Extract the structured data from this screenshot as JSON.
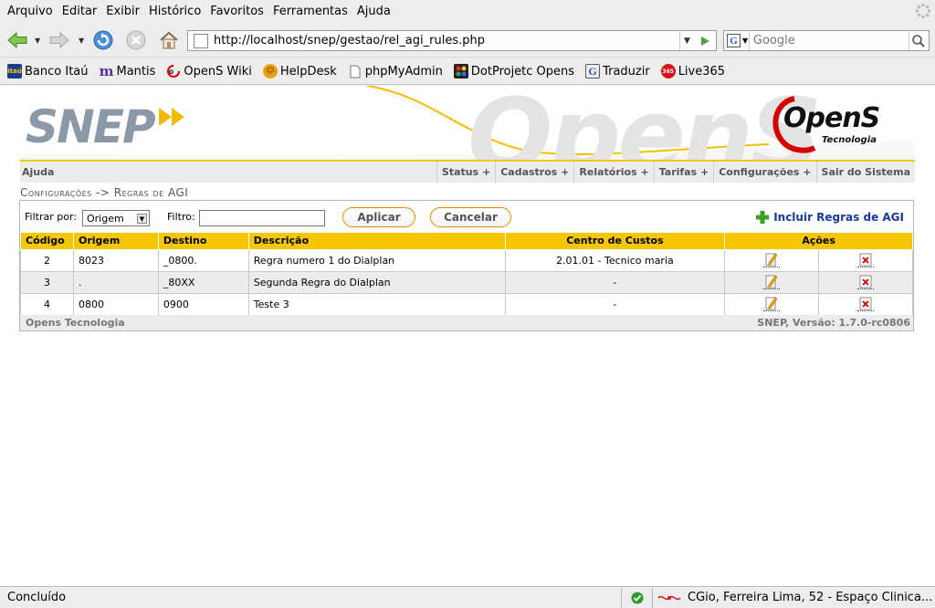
{
  "menubar": {
    "items": [
      "Arquivo",
      "Editar",
      "Exibir",
      "Histórico",
      "Favoritos",
      "Ferramentas",
      "Ajuda"
    ]
  },
  "navbar": {
    "url": "http://localhost/snep/gestao/rel_agi_rules.php",
    "search_placeholder": "Google"
  },
  "bookmarks": [
    {
      "label": "Banco Itaú",
      "icon": "itau-icon"
    },
    {
      "label": "Mantis",
      "icon": "mantis-icon"
    },
    {
      "label": "OpenS Wiki",
      "icon": "opens-icon"
    },
    {
      "label": "HelpDesk",
      "icon": "helpdesk-icon"
    },
    {
      "label": "phpMyAdmin",
      "icon": "page-icon"
    },
    {
      "label": "DotProjetc Opens",
      "icon": "dotproject-icon"
    },
    {
      "label": "Traduzir",
      "icon": "google-icon"
    },
    {
      "label": "Live365",
      "icon": "live365-icon"
    }
  ],
  "header": {
    "logo_left": "SNEP",
    "logo_right": "OpenS",
    "logo_right_sub": "Tecnologia",
    "watermark": "OpenS"
  },
  "menu2": {
    "help": "Ajuda",
    "items": [
      "Status +",
      "Cadastros +",
      "Relatórios +",
      "Tarifas +",
      "Configurações +",
      "Sair do Sistema"
    ]
  },
  "breadcrumb": "Configurações -> Regras de AGI",
  "filter": {
    "filter_by_label": "Filtrar por:",
    "filter_by_value": "Origem",
    "filter_label": "Filtro:",
    "filter_value": "",
    "apply_label": "Aplicar",
    "cancel_label": "Cancelar",
    "add_label": "Incluir Regras de AGI"
  },
  "table": {
    "headers": [
      "Código",
      "Origem",
      "Destino",
      "Descrição",
      "Centro de Custos",
      "Ações"
    ],
    "rows": [
      {
        "codigo": "2",
        "origem": "8023",
        "destino": "_0800.",
        "descricao": "Regra numero 1 do Dialplan",
        "centro": "2.01.01 - Tecnico maria"
      },
      {
        "codigo": "3",
        "origem": ".",
        "destino": "_80XX",
        "descricao": "Segunda Regra do Dialplan",
        "centro": "-"
      },
      {
        "codigo": "4",
        "origem": "0800",
        "destino": "0900",
        "descricao": "Teste 3",
        "centro": "-"
      }
    ]
  },
  "footer": {
    "left": "Opens Tecnologia",
    "right": "SNEP, Versão: 1.7.0-rc0806"
  },
  "statusbar": {
    "status": "Concluído",
    "extension_text": "CGio, Ferreira Lima, 52 - Espaço Clinica..."
  },
  "colors": {
    "accent_yellow": "#f6c700",
    "button_border": "#e08800",
    "link_blue": "#1a3a9a"
  }
}
